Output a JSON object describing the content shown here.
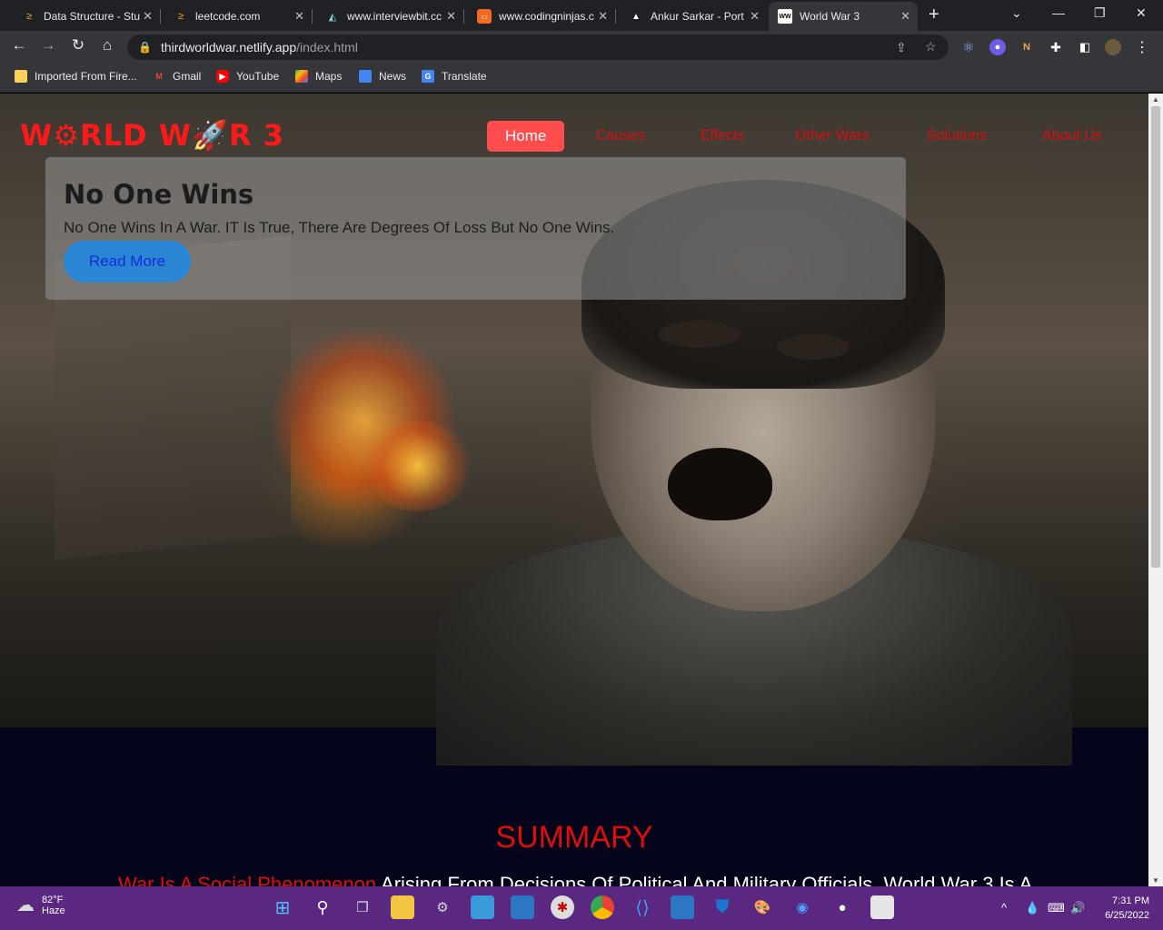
{
  "browser": {
    "tabs": [
      {
        "title": "Data Structure - Stu",
        "icon": "coding-icon"
      },
      {
        "title": "leetcode.com",
        "icon": "leetcode-icon"
      },
      {
        "title": "www.interviewbit.cc",
        "icon": "interviewbit-icon"
      },
      {
        "title": "www.codingninjas.c",
        "icon": "codingninjas-icon"
      },
      {
        "title": "Ankur Sarkar - Port",
        "icon": "triangle-icon"
      },
      {
        "title": "World War 3",
        "icon": "ww-icon",
        "favicon_text": "WW",
        "active": true
      }
    ],
    "address": {
      "host": "thirdworldwar.netlify.app",
      "path": "/index.html"
    },
    "bookmarks": [
      {
        "label": "Imported From Fire...",
        "icon": "folder-icon"
      },
      {
        "label": "Gmail",
        "icon": "gmail-icon",
        "glyph": "M"
      },
      {
        "label": "YouTube",
        "icon": "youtube-icon",
        "glyph": "▶"
      },
      {
        "label": "Maps",
        "icon": "maps-icon"
      },
      {
        "label": "News",
        "icon": "news-icon"
      },
      {
        "label": "Translate",
        "icon": "translate-icon",
        "glyph": "G"
      }
    ],
    "extensions": {
      "notion_glyph": "N"
    }
  },
  "site": {
    "logo": "W⚙RLD W🚀R 3",
    "nav": [
      {
        "label": "Home",
        "active": true
      },
      {
        "label": "Causes"
      },
      {
        "label": "Effects"
      },
      {
        "label": "Other Wars"
      },
      {
        "label": "Solutions"
      },
      {
        "label": "About Us"
      }
    ],
    "hero": {
      "title": "No One Wins",
      "text": "No One Wins In A War. IT Is True, There Are Degrees Of Loss But No One Wins.",
      "button": "Read More"
    },
    "summary": {
      "heading": "SUMMARY",
      "text_red": "War Is A Social Phenomenon",
      "text_white": " Arising From Decisions Of Political And Military Officials. World War 3 Is A"
    }
  },
  "taskbar": {
    "weather": {
      "temp": "82°F",
      "condition": "Haze"
    },
    "time": "7:31 PM",
    "date": "6/25/2022"
  },
  "colors": {
    "accent": "#ff4d4d",
    "nav_link": "#d41010",
    "taskbar": "#5a2880"
  }
}
